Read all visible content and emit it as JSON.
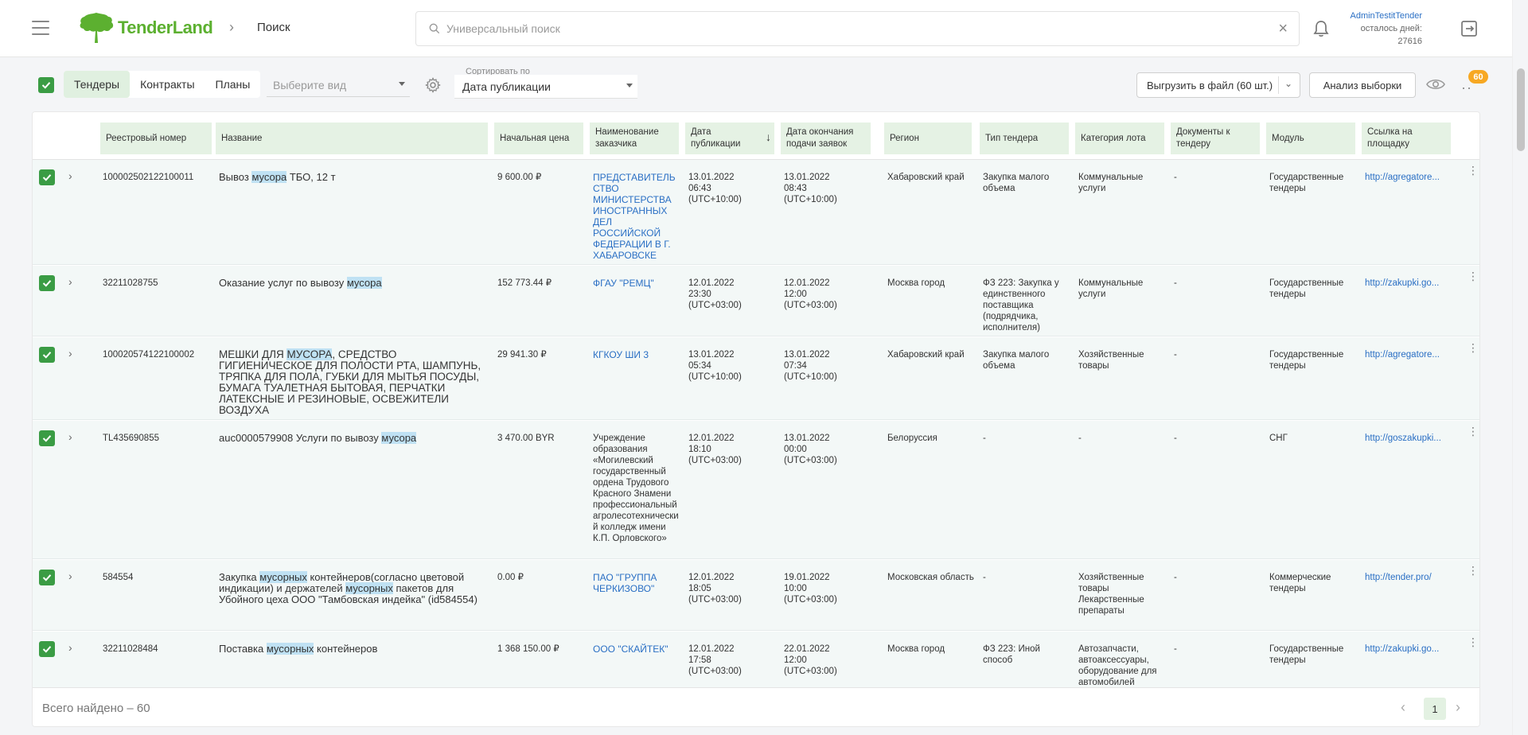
{
  "header": {
    "logo_text": "TenderLand",
    "page_title": "Поиск",
    "search_placeholder": "Универсальный поиск",
    "user_name": "AdminTestitTender",
    "days_label": "осталось дней:",
    "days_value": "27616"
  },
  "toolbar": {
    "tabs": [
      "Тендеры",
      "Контракты",
      "Планы"
    ],
    "view_placeholder": "Выберите вид",
    "sort_label": "Сортировать по",
    "sort_value": "Дата публикации",
    "export_label": "Выгрузить в файл (60 шт.)",
    "analysis_label": "Анализ выборки",
    "badge_count": "60"
  },
  "table": {
    "columns": [
      "Реестровый номер",
      "Название",
      "Начальная цена",
      "Наименование заказчика",
      "Дата публикации",
      "Дата окончания подачи заявок",
      "Регион",
      "Тип тендера",
      "Категория лота",
      "Документы к тендеру",
      "Модуль",
      "Ссылка на площадку"
    ],
    "sort_indicator": "↓",
    "rows": [
      {
        "reg": "100002502122100011",
        "name": [
          [
            "Вывоз ",
            false
          ],
          [
            "мусора",
            true
          ],
          [
            " ТБО, 12 т",
            false
          ]
        ],
        "price": "9 600.00 ₽",
        "customer": "ПРЕДСТАВИТЕЛЬСТВО МИНИСТЕРСТВА ИНОСТРАННЫХ ДЕЛ РОССИЙСКОЙ ФЕДЕРАЦИИ В Г. ХАБАРОВСКЕ",
        "customer_link": true,
        "pub": "13.01.2022 06:43 (UTC+10:00)",
        "end": "13.01.2022 08:43 (UTC+10:00)",
        "region": "Хабаровский край",
        "type": "Закупка малого объема",
        "category": "Коммунальные услуги",
        "docs": "-",
        "module": "Государственные тендеры",
        "link": "http://agregatore..."
      },
      {
        "reg": "32211028755",
        "name": [
          [
            "Оказание услуг по вывозу ",
            false
          ],
          [
            "мусора",
            true
          ]
        ],
        "price": "152 773.44 ₽",
        "customer": "ФГАУ \"РЕМЦ\"",
        "customer_link": true,
        "pub": "12.01.2022 23:30 (UTC+03:00)",
        "end": "12.01.2022 12:00 (UTC+03:00)",
        "region": "Москва город",
        "type": "ФЗ 223: Закупка у единственного поставщика (подрядчика, исполнителя)",
        "category": "Коммунальные услуги",
        "docs": "-",
        "module": "Государственные тендеры",
        "link": "http://zakupki.go..."
      },
      {
        "reg": "100020574122100002",
        "name": [
          [
            "МЕШКИ ДЛЯ ",
            false
          ],
          [
            "МУСОРА",
            true
          ],
          [
            ", СРЕДСТВО ГИГИЕНИЧЕСКОЕ ДЛЯ ПОЛОСТИ РТА, ШАМПУНЬ, ТРЯПКА ДЛЯ ПОЛА, ГУБКИ ДЛЯ МЫТЬЯ ПОСУДЫ, БУМАГА ТУАЛЕТНАЯ БЫТОВАЯ, ПЕРЧАТКИ ЛАТЕКСНЫЕ И РЕЗИНОВЫЕ, ОСВЕЖИТЕЛИ ВОЗДУХА",
            false
          ]
        ],
        "price": "29 941.30 ₽",
        "customer": "КГКОУ ШИ 3",
        "customer_link": true,
        "pub": "13.01.2022 05:34 (UTC+10:00)",
        "end": "13.01.2022 07:34 (UTC+10:00)",
        "region": "Хабаровский край",
        "type": "Закупка малого объема",
        "category": "Хозяйственные товары",
        "docs": "-",
        "module": "Государственные тендеры",
        "link": "http://agregatore..."
      },
      {
        "reg": "TL435690855",
        "name": [
          [
            "auc0000579908 Услуги по вывозу ",
            false
          ],
          [
            "мусора",
            true
          ]
        ],
        "price": "3 470.00 BYR",
        "customer": "Учреждение образования «Могилевский государственный ордена Трудового Красного Знамени профессиональный агролесотехнический колледж имени К.П. Орловского»",
        "customer_link": false,
        "pub": "12.01.2022 18:10 (UTC+03:00)",
        "end": "13.01.2022 00:00 (UTC+03:00)",
        "region": "Белоруссия",
        "type": "-",
        "category": "-",
        "docs": "-",
        "module": "СНГ",
        "link": "http://goszakupki..."
      },
      {
        "reg": "584554",
        "name": [
          [
            "Закупка ",
            false
          ],
          [
            "мусорных",
            true
          ],
          [
            " контейнеров(согласно цветовой индикации) и держателей ",
            false
          ],
          [
            "мусорных",
            true
          ],
          [
            " пакетов для Убойного цеха ООО \"Тамбовская индейка\" (id584554)",
            false
          ]
        ],
        "price": "0.00 ₽",
        "customer": "ПАО \"ГРУППА ЧЕРКИЗОВО\"",
        "customer_link": true,
        "pub": "12.01.2022 18:05 (UTC+03:00)",
        "end": "19.01.2022 10:00 (UTC+03:00)",
        "region": "Московская область",
        "type": "-",
        "category": "Хозяйственные товары Лекарственные препараты",
        "docs": "-",
        "module": "Коммерческие тендеры",
        "link": "http://tender.pro/"
      },
      {
        "reg": "32211028484",
        "name": [
          [
            "Поставка ",
            false
          ],
          [
            "мусорных",
            true
          ],
          [
            " контейнеров",
            false
          ]
        ],
        "price": "1 368 150.00 ₽",
        "customer": "ООО \"СКАЙТЕК\"",
        "customer_link": true,
        "pub": "12.01.2022 17:58 (UTC+03:00)",
        "end": "22.01.2022 12:00 (UTC+03:00)",
        "region": "Москва город",
        "type": "ФЗ 223: Иной способ",
        "category": "Автозапчасти, автоаксессуары, оборудование для автомобилей",
        "docs": "-",
        "module": "Государственные тендеры",
        "link": "http://zakupki.go..."
      }
    ]
  },
  "footer": {
    "total_label": "Всего найдено – 60",
    "page": "1"
  },
  "colors": {
    "brand_green": "#5cb030",
    "checkbox_green": "#3a9c44",
    "header_cell_bg": "#e5f2e4",
    "row_bg": "#f3f8f7",
    "link_blue": "#2a6fc4",
    "highlight": "#bfe1f3",
    "badge_orange": "#f7a823"
  },
  "icons": [
    "menu-icon",
    "tree-logo-icon",
    "chevron-right-icon",
    "search-icon",
    "close-icon",
    "bell-icon",
    "logout-icon",
    "check-icon",
    "settings-gear-icon",
    "eye-icon",
    "more-icon",
    "expand-chevron-icon",
    "kebab-icon"
  ]
}
